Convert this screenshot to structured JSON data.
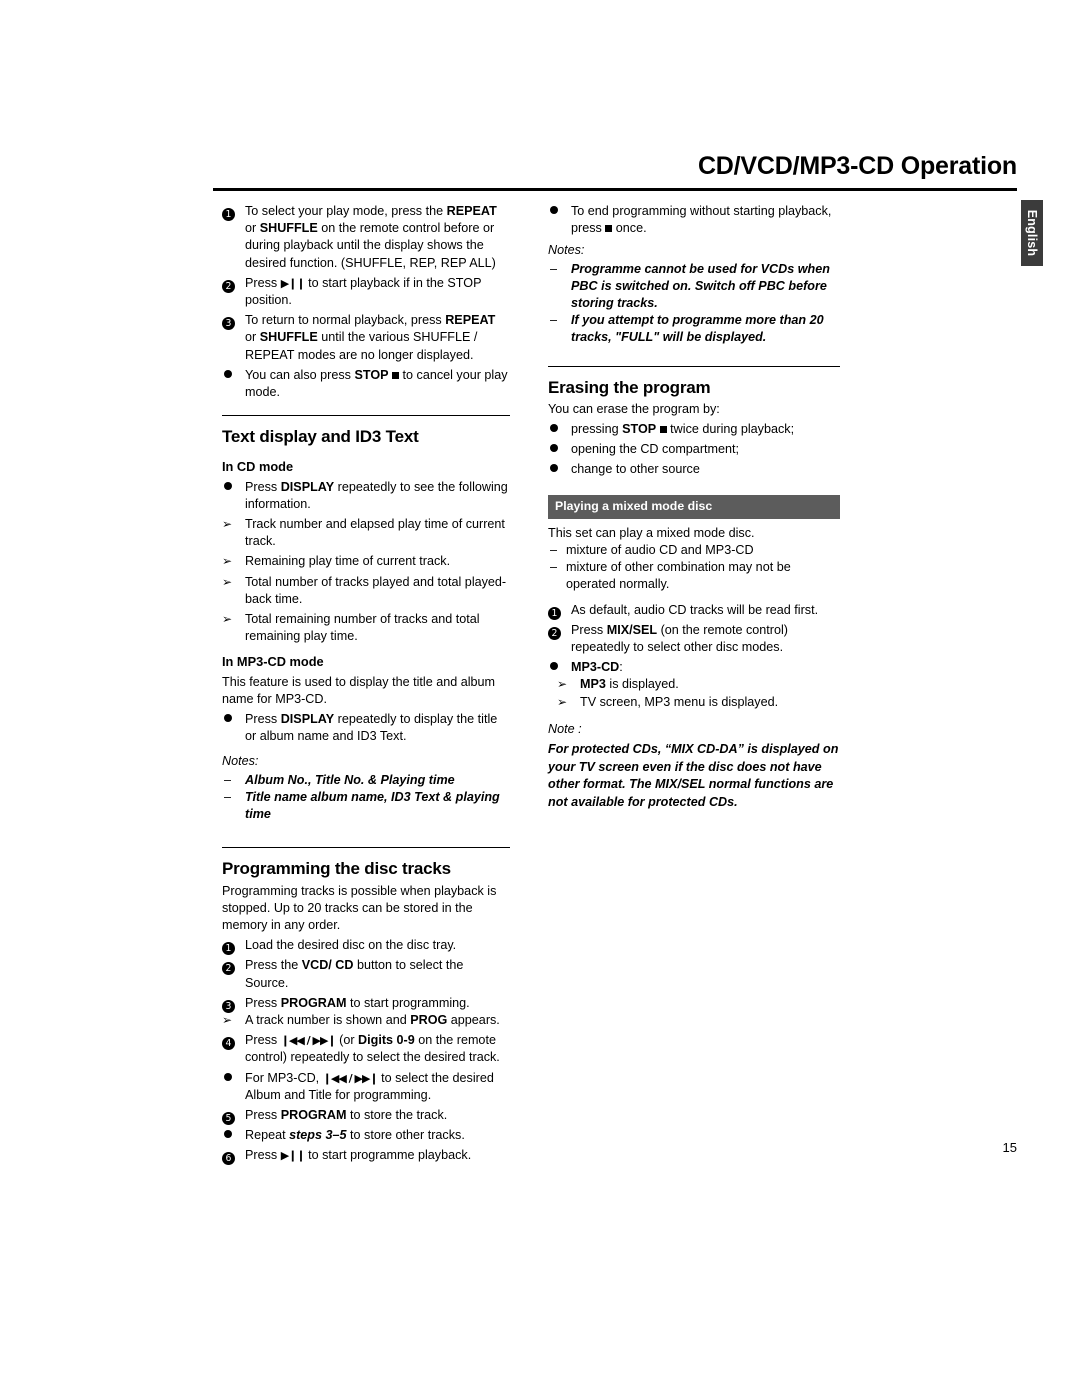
{
  "header": {
    "title": "CD/VCD/MP3-CD Operation",
    "side_tab": "English",
    "page_number": "15"
  },
  "left_column": {
    "playmode": {
      "item1": "To select your play mode, press the REPEAT or SHUFFLE on the remote control before or during playback until the display shows the desired function. (SHUFFLE, REP, REP ALL)",
      "item1_parts": {
        "a": "To select your play mode, press the ",
        "b1": "REPEAT",
        "c": " or ",
        "b2": "SHUFFLE",
        "d": " on the remote control before or during playback until the display shows the desired function. (SHUFFLE, REP, REP ALL)"
      },
      "item2_a": "Press ",
      "item2_b": " to start playback if in the STOP position.",
      "item3_a": "To return to normal playback, press ",
      "item3_b1": "REPEAT",
      "item3_c": " or ",
      "item3_b2": "SHUFFLE",
      "item3_d": " until the various SHUFFLE / REPEAT modes are no longer displayed.",
      "item4_a": "You can also press ",
      "item4_b": "STOP",
      "item4_c": " to cancel your play mode."
    },
    "text_display": {
      "heading": "Text display and ID3 Text",
      "cd_mode_head": "In CD mode",
      "cd_item1_a": "Press ",
      "cd_item1_b": "DISPLAY",
      "cd_item1_c": " repeatedly to see the following information.",
      "arrow1": "Track number and elapsed play time of current track.",
      "arrow2": "Remaining play time of current track.",
      "arrow3": "Total number of tracks played and total played-back time.",
      "arrow4": "Total remaining number of tracks and total remaining play time.",
      "mp3_mode_head": "In MP3-CD mode",
      "mp3_text": "This feature is used to display the title and album name for MP3-CD.",
      "mp3_item1_a": "Press ",
      "mp3_item1_b": "DISPLAY",
      "mp3_item1_c": " repeatedly to display the title or album name and ID3 Text.",
      "notes_label": "Notes:",
      "note1": "Album No., Title No. & Playing time",
      "note2": "Title name album name, ID3 Text & playing time"
    },
    "programming": {
      "heading": "Programming the disc tracks",
      "intro": "Programming tracks is possible when playback is stopped. Up to 20 tracks can be stored in the memory in any order.",
      "step1": "Load the desired disc on the disc tray.",
      "step2_a": "Press the ",
      "step2_b": "VCD/ CD",
      "step2_c": " button to select the Source.",
      "step3_a": "Press ",
      "step3_b": "PROGRAM",
      "step3_c": " to start programming.",
      "step3_arrow_a": "A track number is shown and ",
      "step3_arrow_b": "PROG",
      "step3_arrow_c": " appears.",
      "step4_a": "Press ",
      "step4_b": " (or ",
      "step4_c": "Digits 0-9",
      "step4_d": " on the remote control) repeatedly to select the desired track.",
      "step4_bullet_a": "For MP3-CD, ",
      "step4_bullet_b": " to select the desired Album and Title for programming.",
      "step5_a": "Press ",
      "step5_b": "PROGRAM",
      "step5_c": " to store the track.",
      "step5_bullet_a": "Repeat ",
      "step5_bullet_b": "steps 3–5",
      "step5_bullet_c": " to store other tracks.",
      "step6_a": "Press ",
      "step6_b": " to start programme playback."
    }
  },
  "right_column": {
    "end_programming": {
      "bullet_a": "To end programming without starting playback, press ",
      "bullet_b": " once.",
      "notes_label": "Notes:",
      "note1": "Programme cannot be used for VCDs when PBC is switched on. Switch off PBC before storing tracks.",
      "note2": "If you attempt to programme more than 20 tracks, \"FULL\" will be displayed."
    },
    "erasing": {
      "heading": "Erasing the program",
      "intro": "You can erase the program by:",
      "b1_a": "pressing ",
      "b1_b": "STOP",
      "b1_c": " twice during playback;",
      "b2": "opening the CD compartment;",
      "b3": "change to other source"
    },
    "mixed_mode": {
      "bar_title": "Playing a mixed mode disc",
      "intro": "This set can play a mixed mode disc.",
      "dash1": "mixture of audio CD and MP3-CD",
      "dash2": "mixture of other combination may not be operated normally.",
      "step1": "As default, audio CD tracks will be read first.",
      "step2_a": "Press ",
      "step2_b": "MIX/SEL",
      "step2_c": " (on the remote control) repeatedly to select other disc modes.",
      "bullet_mp3cd": "MP3-CD",
      "bullet_mp3cd_colon": ":",
      "arrow1_a": "MP3",
      "arrow1_b": " is displayed.",
      "arrow2": "TV screen, MP3 menu is displayed.",
      "note_label": "Note :",
      "note_text": "For protected CDs, “MIX CD-DA” is displayed on your TV screen even if the disc does not have other format. The MIX/SEL normal functions are not available for protected CDs."
    }
  }
}
